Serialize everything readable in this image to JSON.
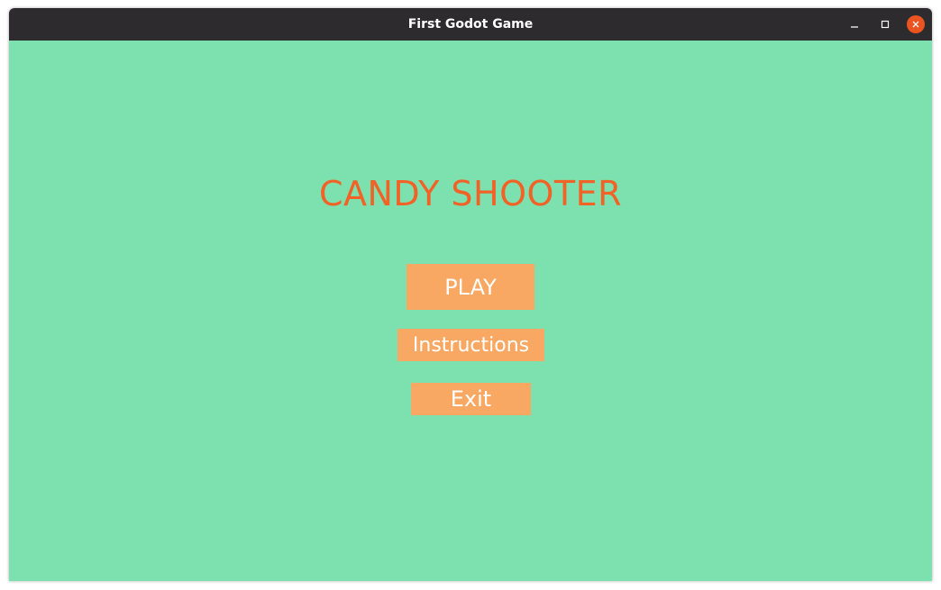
{
  "window": {
    "title": "First Godot Game",
    "controls": {
      "minimize_icon": "minimize-icon",
      "maximize_icon": "maximize-icon",
      "close_icon": "close-icon"
    },
    "accent_color": "#e95420"
  },
  "game": {
    "background_color": "#7de1af",
    "title": "CANDY SHOOTER",
    "title_color": "#f26125",
    "button_color": "#f8a862",
    "menu": {
      "play_label": "PLAY",
      "instructions_label": "Instructions",
      "exit_label": "Exit"
    }
  }
}
